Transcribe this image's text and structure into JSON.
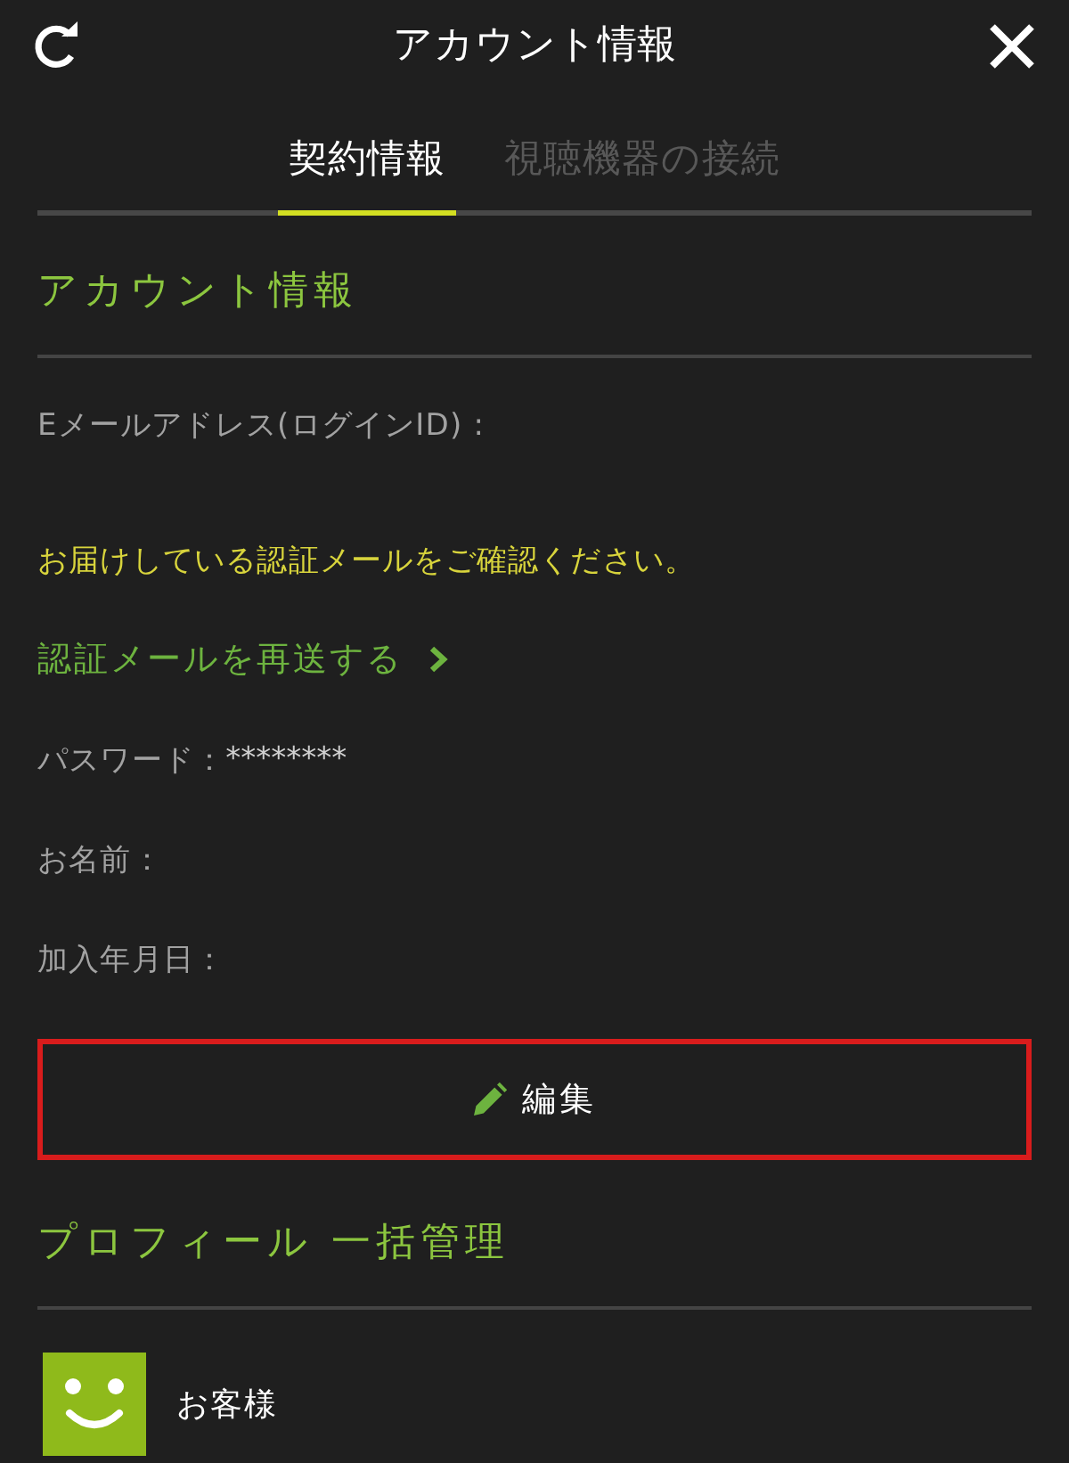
{
  "header": {
    "title": "アカウント情報"
  },
  "tabs": [
    {
      "label": "契約情報",
      "selected": true
    },
    {
      "label": "視聴機器の接続",
      "selected": false
    }
  ],
  "account_section": {
    "title": "アカウント情報",
    "rows": [
      {
        "kind": "field",
        "label": "Eメールアドレス(ログインID) :"
      },
      {
        "kind": "notice",
        "text": "お届けしている認証メールをご確認ください。"
      },
      {
        "kind": "link",
        "text": "認証メールを再送する"
      },
      {
        "kind": "field",
        "label": "パスワード：",
        "value": "********"
      },
      {
        "kind": "field",
        "label": "お名前："
      },
      {
        "kind": "field",
        "label": "加入年月日："
      }
    ],
    "edit_button": {
      "label": "編集"
    }
  },
  "profile_section": {
    "title": "プロフィール 一括管理",
    "profiles": [
      {
        "name": "お客様"
      }
    ]
  }
}
